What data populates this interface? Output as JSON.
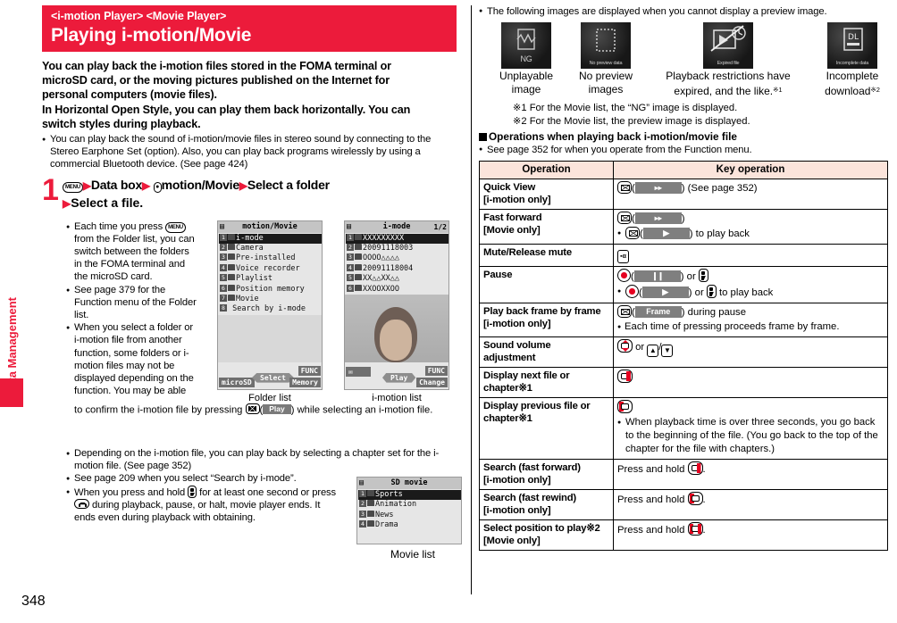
{
  "page": {
    "number": "348",
    "side_tab": "Data Management"
  },
  "header": {
    "sub": "<i-motion Player> <Movie Player>",
    "title": "Playing i-motion/Movie"
  },
  "intro": {
    "lines": [
      "You can play back the i-motion files stored in the FOMA terminal or",
      "microSD card, or the moving pictures published on the Internet for",
      "personal computers (movie files).",
      "In Horizontal Open Style, you can play them back horizontally. You can",
      "switch styles during playback."
    ],
    "bullet": "You can play back the sound of i-motion/movie files in stereo sound by connecting to the Stereo Earphone Set (option). Also, you can play back programs wirelessly by using a commercial Bluetooth device. (See page 424)"
  },
  "step": {
    "number": "1",
    "key_menu": "MENU",
    "line1_a": "Data box",
    "line1_b": "motion/Movie",
    "line1_c": "Select a folder",
    "line2": "Select a file."
  },
  "step_notes": [
    "Each time you press [MENU] from the Folder list, you can switch between the folders in the FOMA terminal and the microSD card.",
    "See page 379 for the Function menu of the Folder list.",
    "When you select a folder or i-motion file from another function, some folders or i-motion files may not be displayed depending on the function. You may be able to confirm the i-motion file by pressing [mail]( Play ) while selecting an i-motion file.",
    "Depending on the i-motion file, you can play back by selecting a chapter set for the i-motion file. (See page 352)",
    "See page 209 when you select “Search by i-mode”.",
    "When you press and hold [soft] for at least one second or press [end] during playback, pause, or halt, movie player ends. It ends even during playback with obtaining."
  ],
  "note_fragments": {
    "n1_a": "Each time you press",
    "n1_b": "from the Folder list, you can switch between the folders in the FOMA terminal and the microSD card.",
    "n2": "See page 379 for the Function menu of the Folder list.",
    "n3_a": "When you select a folder or i-motion file from another function, some folders or i-motion files may not be displayed depending on the function. You may be able",
    "n3_b": "to confirm the i-motion file by pressing",
    "n3_c": ") while selecting an i-motion file.",
    "n3_soft": "Play",
    "n4": "Depending on the i-motion file, you can play back by selecting a chapter set for the i-motion file. (See page 352)",
    "n5": "See page 209 when you select “Search by i-mode”.",
    "n6_a": "When you press and hold",
    "n6_b": "for at least one second or press",
    "n6_c": "during playback, pause, or halt, movie player ends. It ends even during playback with obtaining."
  },
  "folder_list": {
    "caption": "Folder list",
    "title": "motion/Movie",
    "items": [
      "i-mode",
      "Camera",
      "Pre-installed",
      "Voice recorder",
      "Playlist",
      "Position memory",
      "Movie",
      "Search by i-mode"
    ],
    "soft_left": "microSD",
    "soft_center": "Select",
    "soft_right_top": "FUNC",
    "soft_right_bottom": "Memory"
  },
  "imotion_list": {
    "caption": "i-motion list",
    "title": "i-mode",
    "counter": "1/2",
    "items": [
      "XXXXXXXXX",
      "20091118003",
      "OOOO△△△△",
      "20091118004",
      "XX△△XX△△",
      "XXOOXXOO"
    ],
    "soft_center": "Play",
    "soft_right_top": "FUNC",
    "soft_right_bottom": "Change"
  },
  "movie_list": {
    "caption": "Movie list",
    "title": "SD movie",
    "items": [
      "Sports",
      "Animation",
      "News",
      "Drama"
    ]
  },
  "preview": {
    "intro": "The following images are displayed when you cannot display a preview image.",
    "thumbs": [
      {
        "badge": "NG",
        "caption_l1": "Unplayable",
        "caption_l2": "image",
        "sup": ""
      },
      {
        "badge": "No preview data",
        "caption_l1": "No preview",
        "caption_l2": "images",
        "sup": ""
      },
      {
        "badge": "Expired file",
        "caption_l1": "Playback restrictions have",
        "caption_l2": "expired, and the like.",
        "sup": "※1"
      },
      {
        "badge": "Incomplete data",
        "caption_l1": "Incomplete",
        "caption_l2": "download",
        "sup": "※2"
      }
    ],
    "notes": [
      "※1  For the Movie list, the “NG” image is displayed.",
      "※2  For the Movie list, the preview image is displayed."
    ]
  },
  "section": {
    "heading": "Operations when playing back i-motion/movie file",
    "bullet": "See page 352 for when you operate from the Function menu."
  },
  "table": {
    "headers": [
      "Operation",
      "Key operation"
    ],
    "rows": [
      {
        "op": "Quick View",
        "op_sub": "[i-motion only]",
        "key_main_pre": "(",
        "key_soft_label": "▸▸",
        "key_main_post": ") (See page 352)",
        "type": "mail-ff-page"
      },
      {
        "op": "Fast forward",
        "op_sub": "[Movie only]",
        "type": "mail-ff-play",
        "sub_text": ") to play back"
      },
      {
        "op": "Mute/Release mute",
        "op_sub": "",
        "type": "mute"
      },
      {
        "op": "Pause",
        "op_sub": "",
        "type": "pause",
        "or_text": "or",
        "sub_text": ") or",
        "sub_text2": "to play back"
      },
      {
        "op": "Play back frame by frame",
        "op_sub": "[i-motion only]",
        "type": "frame",
        "soft_label": "Frame",
        "post_text": ") during pause",
        "sub_text": "Each time of pressing proceeds frame by frame."
      },
      {
        "op": "Sound volume",
        "op_sub": "adjustment",
        "type": "volume",
        "or_text": "or"
      },
      {
        "op": "Display next file or",
        "op_sub": "chapter※1",
        "type": "next"
      },
      {
        "op": "Display previous file or",
        "op_sub": "chapter※1",
        "type": "prev",
        "sub_text": "When playback time is over three seconds, you go back to the beginning of the file. (You go back to the top of the chapter for the file with chapters.)"
      },
      {
        "op": "Search (fast forward)",
        "op_sub": "[i-motion only]",
        "type": "hold-next",
        "press_text": "Press and hold"
      },
      {
        "op": "Search (fast rewind)",
        "op_sub": "[i-motion only]",
        "type": "hold-prev",
        "press_text": "Press and hold"
      },
      {
        "op": "Select position to play※2",
        "op_sub": "[Movie only]",
        "type": "hold-both",
        "press_text": "Press and hold"
      }
    ]
  }
}
